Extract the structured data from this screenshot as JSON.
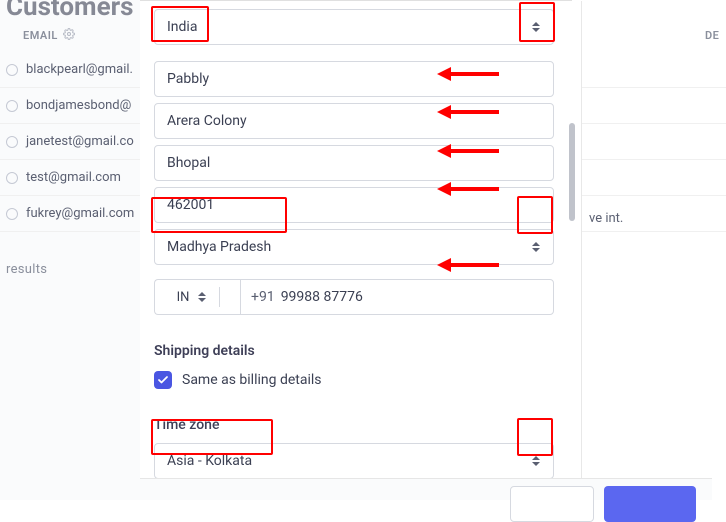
{
  "page": {
    "heading": "Customers",
    "columns": {
      "email": "EMAIL",
      "right": "DE"
    },
    "results": "results"
  },
  "bg_rows": [
    {
      "email": "blackpearl@gmail."
    },
    {
      "email": "bondjamesbond@"
    },
    {
      "email": "janetest@gmail.co"
    },
    {
      "email": "test@gmail.com"
    },
    {
      "email": "fukrey@gmail.com"
    }
  ],
  "bg_plan": "ve int.",
  "form": {
    "country": "India",
    "company": "Pabbly",
    "address": "Arera Colony",
    "city": "Bhopal",
    "postal": "462001",
    "state": "Madhya Pradesh",
    "phone_cc_code": "IN",
    "phone_prefix": "+91",
    "phone_number": "99988 87776",
    "shipping_title": "Shipping details",
    "same_as_billing": "Same as billing details",
    "timezone_title": "Time zone",
    "timezone": "Asia - Kolkata"
  }
}
